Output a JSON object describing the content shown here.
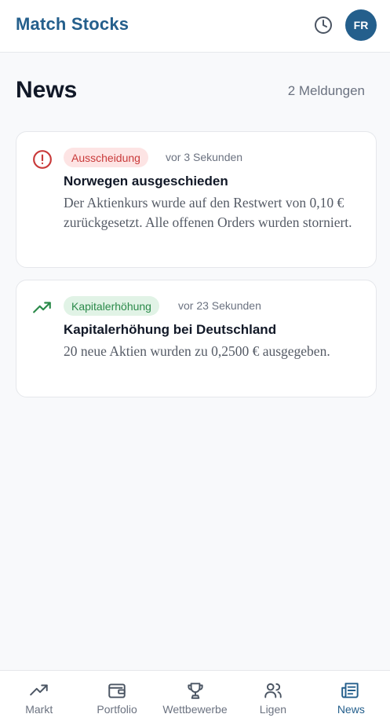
{
  "header": {
    "title": "Match Stocks",
    "history_icon": "clock-icon",
    "avatar_initials": "FR"
  },
  "page": {
    "title": "News",
    "count_label": "2 Meldungen"
  },
  "news": [
    {
      "icon": "alert-circle-icon",
      "badge": "Ausscheidung",
      "badge_color": "#c93a3a",
      "time": "vor 3 Sekunden",
      "title": "Norwegen ausgeschieden",
      "text": "Der Aktienkurs wurde auf den Restwert von 0,10 € zurückgesetzt. Alle offenen Orders wurden storniert."
    },
    {
      "icon": "trending-up-icon",
      "badge": "Kapitalerhöhung",
      "badge_color": "#2b8a4a",
      "time": "vor 23 Sekunden",
      "title": "Kapitalerhöhung bei Deutschland",
      "text": "20 neue Aktien wurden zu 0,2500 € ausgegeben."
    }
  ],
  "nav": [
    {
      "label": "Markt",
      "icon": "trending-up-icon"
    },
    {
      "label": "Portfolio",
      "icon": "wallet-icon"
    },
    {
      "label": "Wettbewerbe",
      "icon": "trophy-icon"
    },
    {
      "label": "Ligen",
      "icon": "users-icon"
    },
    {
      "label": "News",
      "icon": "newspaper-icon",
      "active": true
    }
  ],
  "colors": {
    "brand": "#245f8c",
    "background": "#f8f9fb"
  }
}
